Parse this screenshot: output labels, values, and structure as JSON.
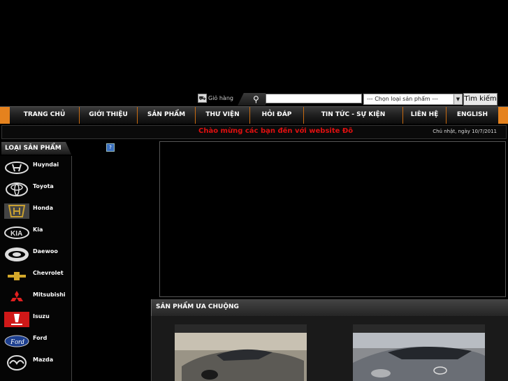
{
  "cart": {
    "label": "Giỏ hàng"
  },
  "search": {
    "placeholder": "",
    "select_value": "--- Chọn loại sản phẩm ---",
    "button": "Tìm kiếm"
  },
  "nav": [
    {
      "label": "TRANG CHỦ"
    },
    {
      "label": "GIỚI THIỆU"
    },
    {
      "label": "SẢN PHẨM"
    },
    {
      "label": "THƯ VIỆN"
    },
    {
      "label": "HỎI ĐÁP"
    },
    {
      "label": "TIN TỨC - SỰ KIỆN"
    },
    {
      "label": "LIÊN HỆ"
    },
    {
      "label": "ENGLISH"
    }
  ],
  "welcome": "Chào mừng các bạn đến với website Đỗ C",
  "date": "Chủ nhật, ngày 10/7/2011",
  "sidebar": {
    "title": "LOẠI SẢN PHẨM",
    "brands": [
      {
        "label": "Huyndai"
      },
      {
        "label": "Toyota"
      },
      {
        "label": "Honda"
      },
      {
        "label": "Kia"
      },
      {
        "label": "Daewoo"
      },
      {
        "label": "Chevrolet"
      },
      {
        "label": "Mitsubishi"
      },
      {
        "label": "Isuzu"
      },
      {
        "label": "Ford"
      },
      {
        "label": "Mazda"
      }
    ]
  },
  "favorites": {
    "title": "SẢN PHẨM ƯA CHUỘNG"
  },
  "colors": {
    "accent": "#e5821e",
    "welcome": "#e01010"
  }
}
